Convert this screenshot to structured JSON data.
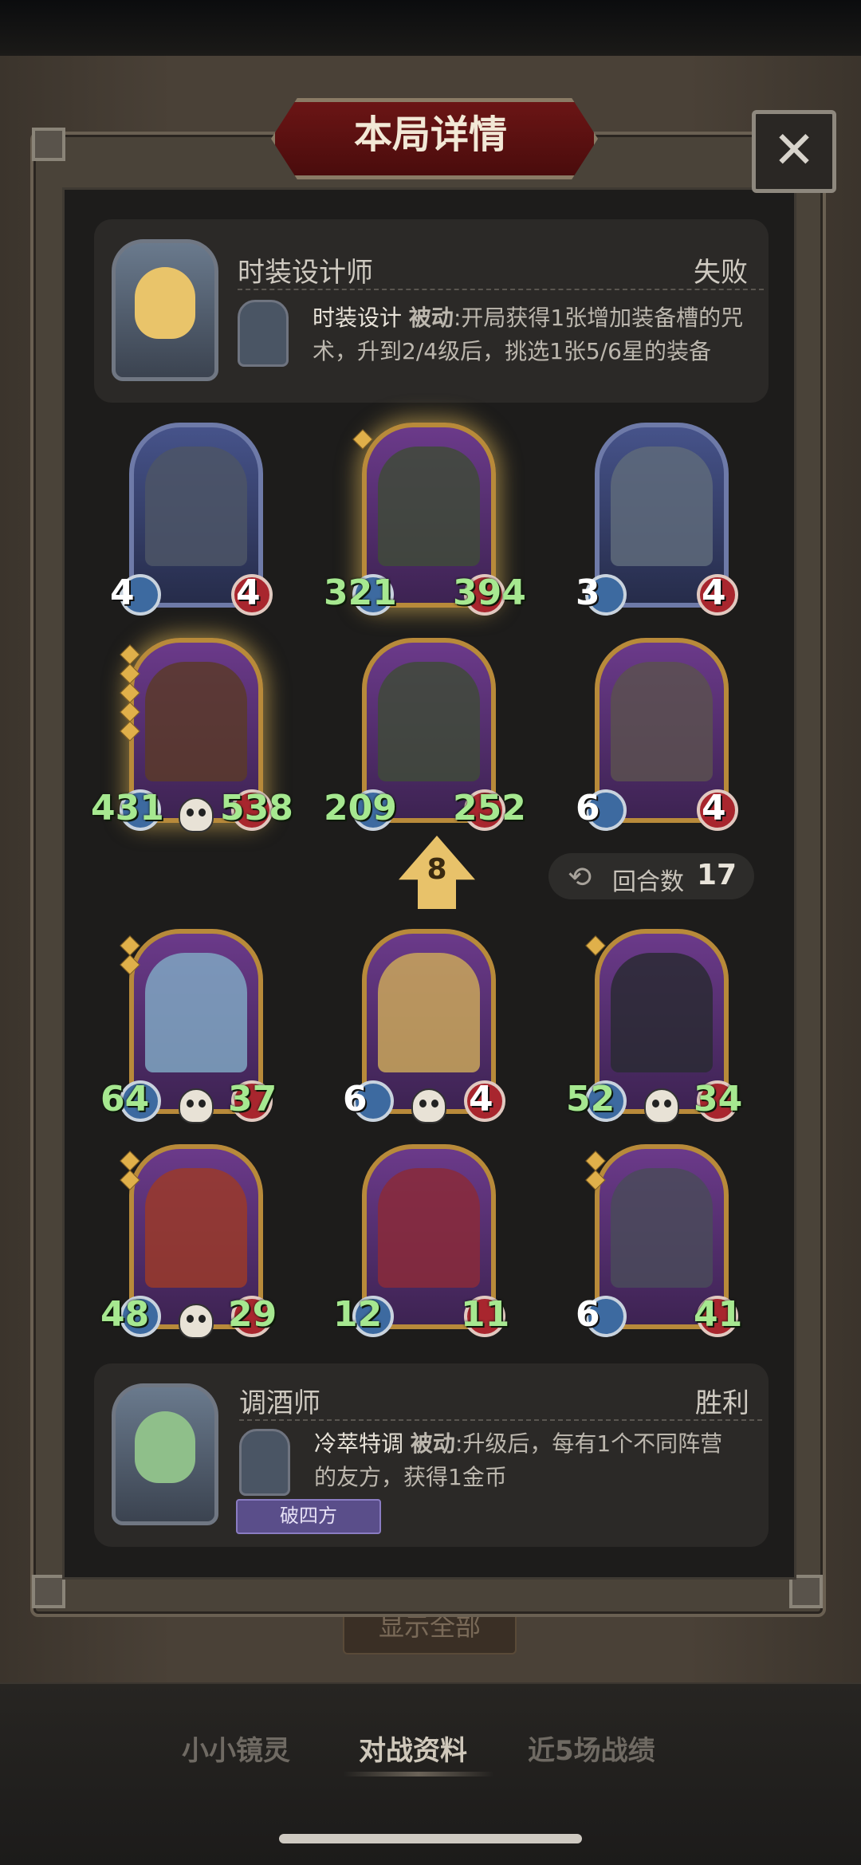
{
  "dialog": {
    "title": "本局详情",
    "close_icon": "✕"
  },
  "top_player": {
    "name": "时装设计师",
    "result": "失败",
    "skill": {
      "name": "时装设计",
      "type": "被动",
      "description_line1": ":开局获得1张增加装备槽的咒",
      "description_line2": "术，升到2/4级后，挑选1张5/6星的装备"
    }
  },
  "top_board": {
    "cards": [
      {
        "attack": "4",
        "health": "4",
        "stars": 0,
        "frame": "blue"
      },
      {
        "attack": "321",
        "health": "394",
        "stars": 1,
        "frame": "gold"
      },
      {
        "attack": "3",
        "health": "4",
        "stars": 0,
        "frame": "blue"
      },
      {
        "attack": "431",
        "health": "538",
        "stars": 5,
        "frame": "gold",
        "skull": true
      },
      {
        "attack": "209",
        "health": "252",
        "stars": 0,
        "frame": "gold"
      },
      {
        "attack": "6",
        "health": "4",
        "stars": 0,
        "frame": "gold"
      }
    ]
  },
  "round_info": {
    "level": "8",
    "round_label": "回合数",
    "round_value": "17"
  },
  "bottom_board": {
    "cards": [
      {
        "attack": "64",
        "health": "37",
        "stars": 2,
        "skull": true
      },
      {
        "attack": "6",
        "health": "4",
        "stars": 0,
        "skull": true
      },
      {
        "attack": "52",
        "health": "34",
        "stars": 1,
        "skull": true
      },
      {
        "attack": "48",
        "health": "29",
        "stars": 2,
        "skull": true
      },
      {
        "attack": "12",
        "health": "11",
        "stars": 0
      },
      {
        "attack": "6",
        "health": "41",
        "stars": 2
      }
    ]
  },
  "bottom_player": {
    "name": "调酒师",
    "result": "胜利",
    "tag": "破四方",
    "skill": {
      "name": "冷萃特调",
      "type": "被动",
      "description_line1": ":升级后，每有1个不同阵营",
      "description_line2": "的友方，获得1金币"
    }
  },
  "background_button": "显示全部",
  "tabs": [
    "小小镜灵",
    "对战资料",
    "近5场战绩"
  ],
  "colors": {
    "stat_green": "#a6e890",
    "title_red": "#6b1515",
    "gold_frame": "#b88a3a"
  }
}
